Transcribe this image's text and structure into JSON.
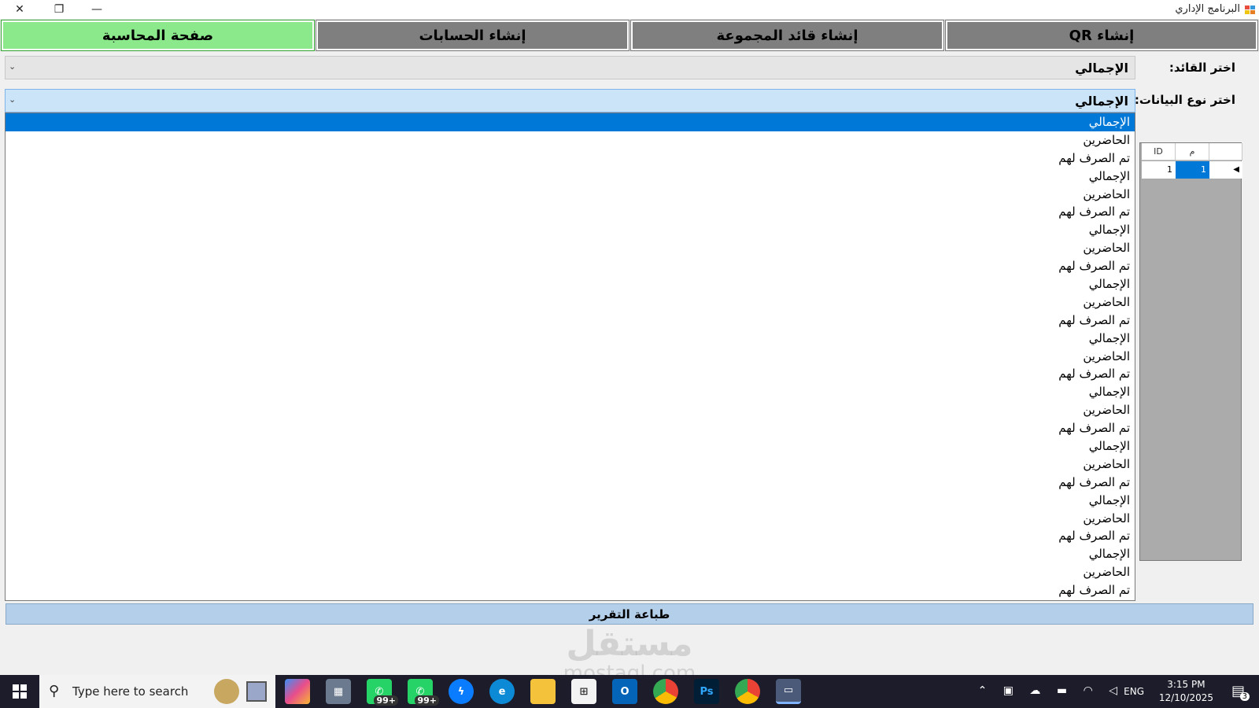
{
  "window": {
    "title": "البرنامج الإداري",
    "close_glyph": "✕",
    "restore_glyph": "❐",
    "minimize_glyph": "—"
  },
  "tabs": [
    {
      "label": "صفحة المحاسبة",
      "active": true
    },
    {
      "label": "إنشاء الحسابات",
      "active": false
    },
    {
      "label": "إنشاء قائد المجموعة",
      "active": false
    },
    {
      "label": "إنشاء QR",
      "active": false
    }
  ],
  "form": {
    "leader_label": "اختر القائد:",
    "leader_value": "الإجمالي",
    "datatype_label": "اختر نوع البيانات:",
    "datatype_value": "الإجمالي",
    "dropdown_arrow": "⌄"
  },
  "dropdown_options": [
    "الإجمالي",
    "الحاضرين",
    "تم الصرف لهم",
    "الإجمالي",
    "الحاضرين",
    "تم الصرف لهم",
    "الإجمالي",
    "الحاضرين",
    "تم الصرف لهم",
    "الإجمالي",
    "الحاضرين",
    "تم الصرف لهم",
    "الإجمالي",
    "الحاضرين",
    "تم الصرف لهم",
    "الإجمالي",
    "الحاضرين",
    "تم الصرف لهم",
    "الإجمالي",
    "الحاضرين",
    "تم الصرف لهم",
    "الإجمالي",
    "الحاضرين",
    "تم الصرف لهم",
    "الإجمالي",
    "الحاضرين",
    "تم الصرف لهم"
  ],
  "grid": {
    "columns": [
      "ID",
      "م"
    ],
    "rows": [
      {
        "id": "1",
        "m": "1"
      }
    ],
    "row_indicator": "◀"
  },
  "print_button": "طباعة التقرير",
  "watermark": {
    "arabic": "مستقل",
    "latin": "mostaql.com"
  },
  "taskbar": {
    "search_placeholder": "Type here to search",
    "badge_whatsapp_1": "99+",
    "badge_whatsapp_2": "99+",
    "lang": "ENG",
    "time": "3:15 PM",
    "date": "12/10/2025",
    "notifications": "3",
    "icons": [
      "copilot-icon",
      "calculator-icon",
      "whatsapp-icon",
      "whatsapp-icon",
      "messenger-icon",
      "edge-icon",
      "file-explorer-icon",
      "store-icon",
      "outlook-icon",
      "chrome-icon",
      "photoshop-icon",
      "chrome-profile-icon",
      "app-window-icon"
    ],
    "ps_label": "Ps"
  },
  "colors": {
    "active_tab": "#8be88b",
    "inactive_tab": "#7f7f7f",
    "selection": "#0078d7",
    "print_button": "#b4cfea",
    "taskbar": "#1c1c2b"
  }
}
